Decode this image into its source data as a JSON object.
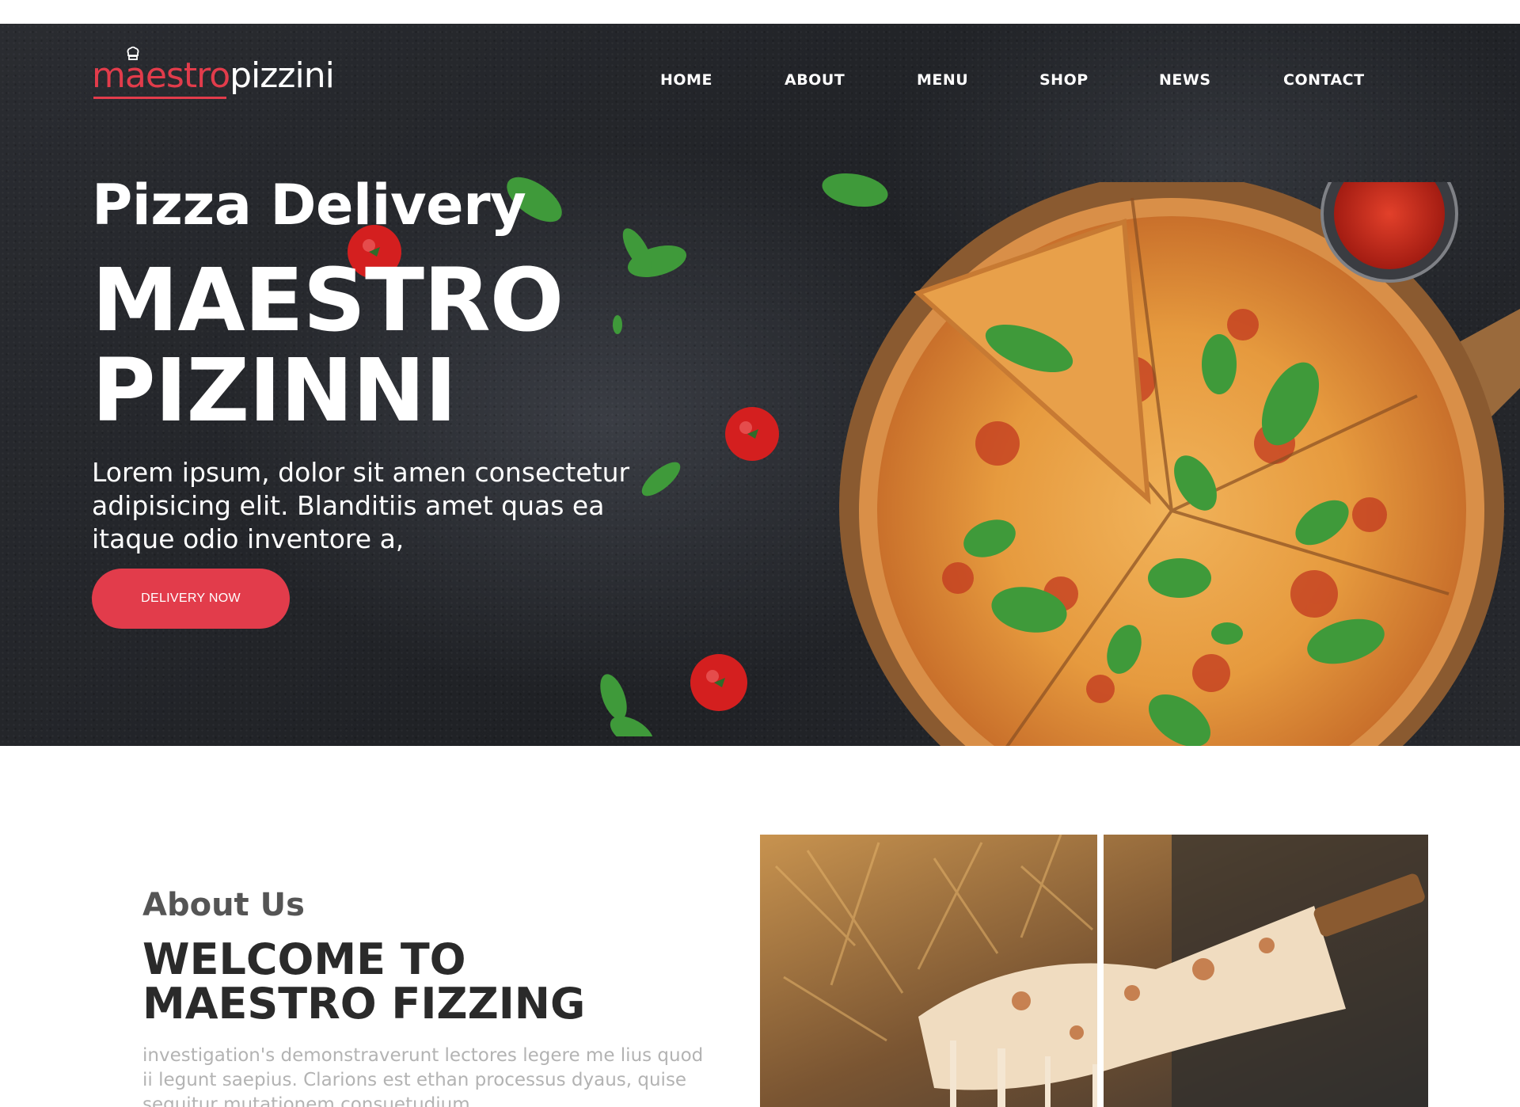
{
  "header": {
    "logo_part_1": "maestro",
    "logo_part_2": "pizzini",
    "nav": [
      "HOME",
      "ABOUT",
      "MENU",
      "SHOP",
      "NEWS",
      "CONTACT"
    ]
  },
  "hero": {
    "subtitle": "Pizza Delivery",
    "title_line_1": "MAESTRO",
    "title_line_2": "PIZINNI",
    "description": "Lorem ipsum, dolor sit amen consectetur adipisicing elit. Blanditiis amet quas ea itaque odio inventore a,",
    "cta_label": "DELIVERY NOW"
  },
  "about": {
    "kicker": "About Us",
    "title_line_1": "WELCOME TO",
    "title_line_2": "MAESTRO FIZZING",
    "text": "investigation's demonstraverunt lectores legere me lius quod ii legunt saepius. Clarions est ethan processus dyaus, quise sequitur mutationem consuetudium"
  },
  "icons": {
    "logo_icon": "chef-hat-icon"
  },
  "colors": {
    "accent": "#e23c4b",
    "hero_bg": "#24262b",
    "text_dark": "#2a2a2a"
  }
}
